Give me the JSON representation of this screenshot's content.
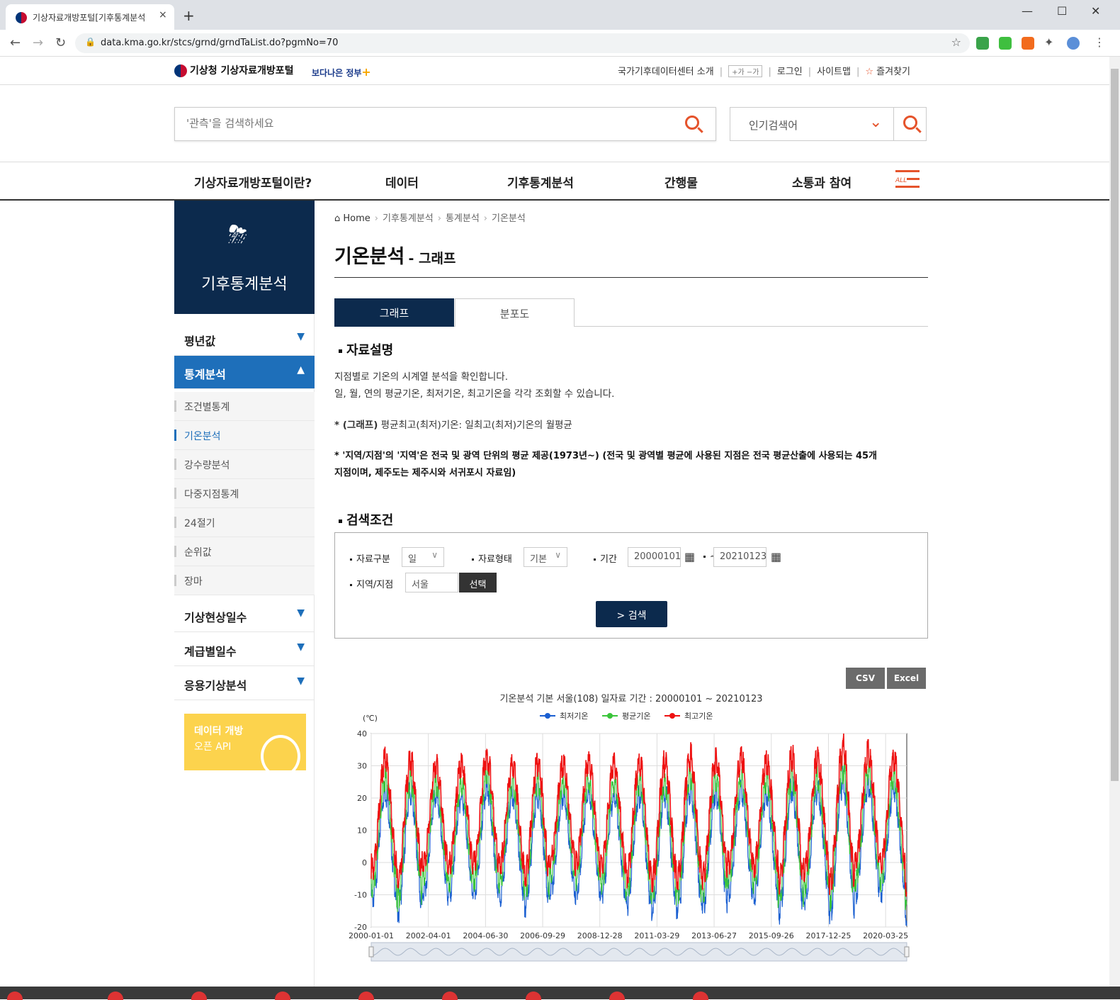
{
  "browser": {
    "tab_title": "기상자료개방포털[기후통계분석",
    "tab_close": "×",
    "new_tab": "+",
    "url": "data.kma.go.kr/stcs/grnd/grndTaList.do?pgmNo=70",
    "win_min": "—",
    "win_max": "☐",
    "win_close": "✕"
  },
  "header": {
    "logo_text": "기상청 기상자료개방포털",
    "slogan": "보다나은 정부",
    "slogan_plus": "+",
    "util_links": [
      "국가기후데이터센터 소개",
      "로그인",
      "사이트맵",
      "즐겨찾기"
    ],
    "font_size_label": "+가 −가",
    "search_placeholder": "'관측'을 검색하세요",
    "popular_label": "인기검색어"
  },
  "gnb": {
    "items": [
      "기상자료개방포털이란?",
      "데이터",
      "기후통계분석",
      "간행물",
      "소통과 참여"
    ],
    "all_label": "ALL"
  },
  "sidebar": {
    "title": "기후통계분석",
    "menu": [
      {
        "label": "평년값",
        "expanded": false
      },
      {
        "label": "통계분석",
        "expanded": true
      },
      {
        "label": "기상현상일수",
        "expanded": false
      },
      {
        "label": "계급별일수",
        "expanded": false
      },
      {
        "label": "응용기상분석",
        "expanded": false
      }
    ],
    "submenu": [
      "조건별통계",
      "기온분석",
      "강수량분석",
      "다중지점통계",
      "24절기",
      "순위값",
      "장마"
    ],
    "active_sub": "기온분석",
    "banner_line1": "데이터 개방",
    "banner_line2": "오픈 API"
  },
  "breadcrumb": [
    "Home",
    "기후통계분석",
    "통계분석",
    "기온분석"
  ],
  "page": {
    "title": "기온분석",
    "subtitle": "- 그래프",
    "tabs": [
      "그래프",
      "분포도"
    ],
    "section_desc": "자료설명",
    "desc_lines": [
      "지점별로 기온의 시계열 분석을 확인합니다.",
      "일, 월, 연의 평균기온, 최저기온, 최고기온을 각각 조회할 수 있습니다."
    ],
    "note1_bold": "* (그래프)",
    "note1_rest": " 평균최고(최저)기온: 일최고(최저)기온의 월평균",
    "note2_line1": "* '지역/지점'의 '지역'은 전국 및 광역 단위의 평균 제공(1973년~) (전국 및 광역별 평균에 사용된 지점은 전국 평균산출에 사용되는 45개",
    "note2_line2": "지점이며, 제주도는 제주시와 서귀포시 자료임)",
    "section_search": "검색조건"
  },
  "search_form": {
    "type_label": "자료구분",
    "type_value": "일",
    "form_label": "자료형태",
    "form_value": "기본",
    "period_label": "기간",
    "start_date": "20000101",
    "tilde": "~",
    "end_date": "20210123",
    "station_label": "지역/지점",
    "station_value": "서울",
    "pick_button": "선택",
    "search_button": "> 검색"
  },
  "downloads": [
    "CSV",
    "Excel"
  ],
  "chart_data": {
    "type": "line",
    "title": "기온분석 기본 서울(108) 일자료 기간 : 20000101 ~ 20210123",
    "ylabel": "(℃)",
    "ylim": [
      -20,
      40
    ],
    "yticks": [
      40,
      30,
      20,
      10,
      0,
      -10,
      -20
    ],
    "x_tick_labels": [
      "2000-01-01",
      "2002-04-01",
      "2004-06-30",
      "2006-09-29",
      "2008-12-28",
      "2011-03-29",
      "2013-06-27",
      "2015-09-26",
      "2017-12-25",
      "2020-03-25"
    ],
    "x_range": [
      "2000-01-01",
      "2021-01-23"
    ],
    "grid": true,
    "legend_position": "top",
    "series": [
      {
        "name": "최저기온",
        "color": "#1a5fd1",
        "annual_min": -17,
        "annual_max": 26
      },
      {
        "name": "평균기온",
        "color": "#3ac43a",
        "annual_min": -13,
        "annual_max": 30
      },
      {
        "name": "최고기온",
        "color": "#ee1111",
        "annual_min": -8,
        "annual_max": 36
      }
    ],
    "annual_extremes": [
      {
        "year": 2000,
        "tmin": -14,
        "tmax": 35
      },
      {
        "year": 2001,
        "tmin": -18,
        "tmax": 35
      },
      {
        "year": 2002,
        "tmin": -12,
        "tmax": 33
      },
      {
        "year": 2003,
        "tmin": -13,
        "tmax": 33
      },
      {
        "year": 2004,
        "tmin": -12,
        "tmax": 36
      },
      {
        "year": 2005,
        "tmin": -13,
        "tmax": 33
      },
      {
        "year": 2006,
        "tmin": -16,
        "tmax": 34
      },
      {
        "year": 2007,
        "tmin": -11,
        "tmax": 33
      },
      {
        "year": 2008,
        "tmin": -12,
        "tmax": 34
      },
      {
        "year": 2009,
        "tmin": -13,
        "tmax": 33
      },
      {
        "year": 2010,
        "tmin": -16,
        "tmax": 34
      },
      {
        "year": 2011,
        "tmin": -17,
        "tmax": 34
      },
      {
        "year": 2012,
        "tmin": -17,
        "tmax": 36
      },
      {
        "year": 2013,
        "tmin": -16,
        "tmax": 35
      },
      {
        "year": 2014,
        "tmin": -12,
        "tmax": 35
      },
      {
        "year": 2015,
        "tmin": -13,
        "tmax": 34
      },
      {
        "year": 2016,
        "tmin": -18,
        "tmax": 36
      },
      {
        "year": 2017,
        "tmin": -14,
        "tmax": 35
      },
      {
        "year": 2018,
        "tmin": -18,
        "tmax": 39
      },
      {
        "year": 2019,
        "tmin": -12,
        "tmax": 37
      },
      {
        "year": 2020,
        "tmin": -12,
        "tmax": 35
      },
      {
        "year": 2021,
        "tmin": -19,
        "tmax": 10
      }
    ]
  },
  "colors": {
    "navy": "#0c2a4d",
    "accent_blue": "#1e6fba",
    "accent_orange": "#e5532b",
    "banner_yellow": "#fcd34d"
  }
}
